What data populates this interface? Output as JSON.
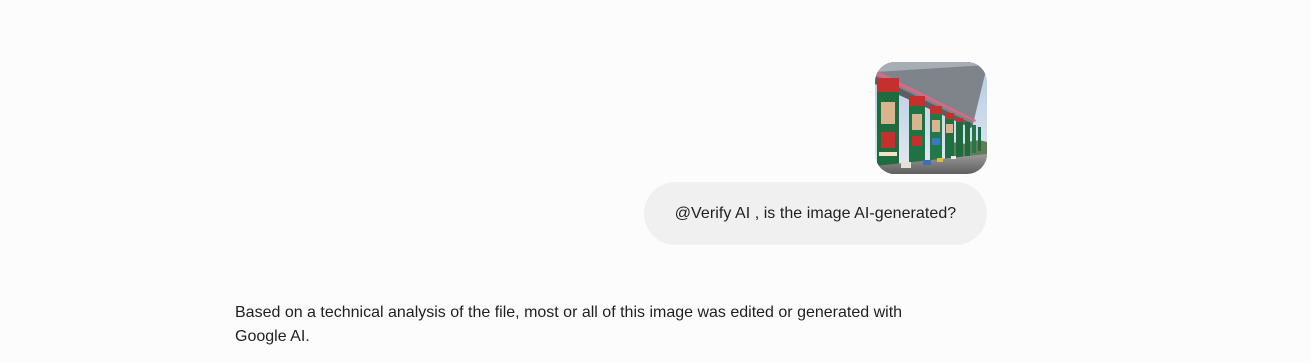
{
  "conversation": {
    "user_message": {
      "attachment": {
        "icon": "train-bridge-photo",
        "colors": {
          "sky": "#b8cde6",
          "bridge": "#8a8f96",
          "pillar_green": "#1d6b3f",
          "pillar_red": "#c4302b"
        }
      },
      "text": "@Verify AI , is the image AI-generated?"
    },
    "model_message": {
      "text": "Based on a technical analysis of the file, most or all of this image was edited or generated with Google AI."
    }
  },
  "colors": {
    "background": "#fcfcfc",
    "user_bubble": "#f0f0f0",
    "text": "#1f1f1f"
  }
}
